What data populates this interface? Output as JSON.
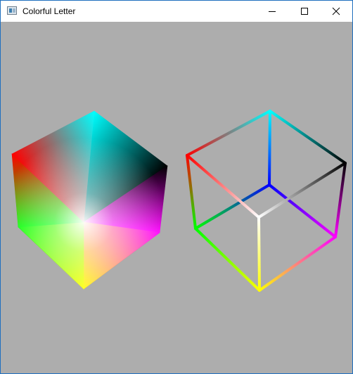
{
  "window": {
    "title": "Colorful Letter",
    "icon": "app-window-icon",
    "controls": [
      {
        "name": "minimize",
        "icon": "minimize-icon"
      },
      {
        "name": "maximize",
        "icon": "maximize-icon"
      },
      {
        "name": "close",
        "icon": "close-icon"
      }
    ]
  },
  "canvas": {
    "background": "#adadad",
    "cube_colors": {
      "red": "#ff0000",
      "cyan": "#00ffff",
      "black": "#000000",
      "green": "#00ff00",
      "magenta": "#ff00ff",
      "yellow": "#ffff00",
      "white": "#ffffff",
      "blue": "#0000ff"
    }
  }
}
